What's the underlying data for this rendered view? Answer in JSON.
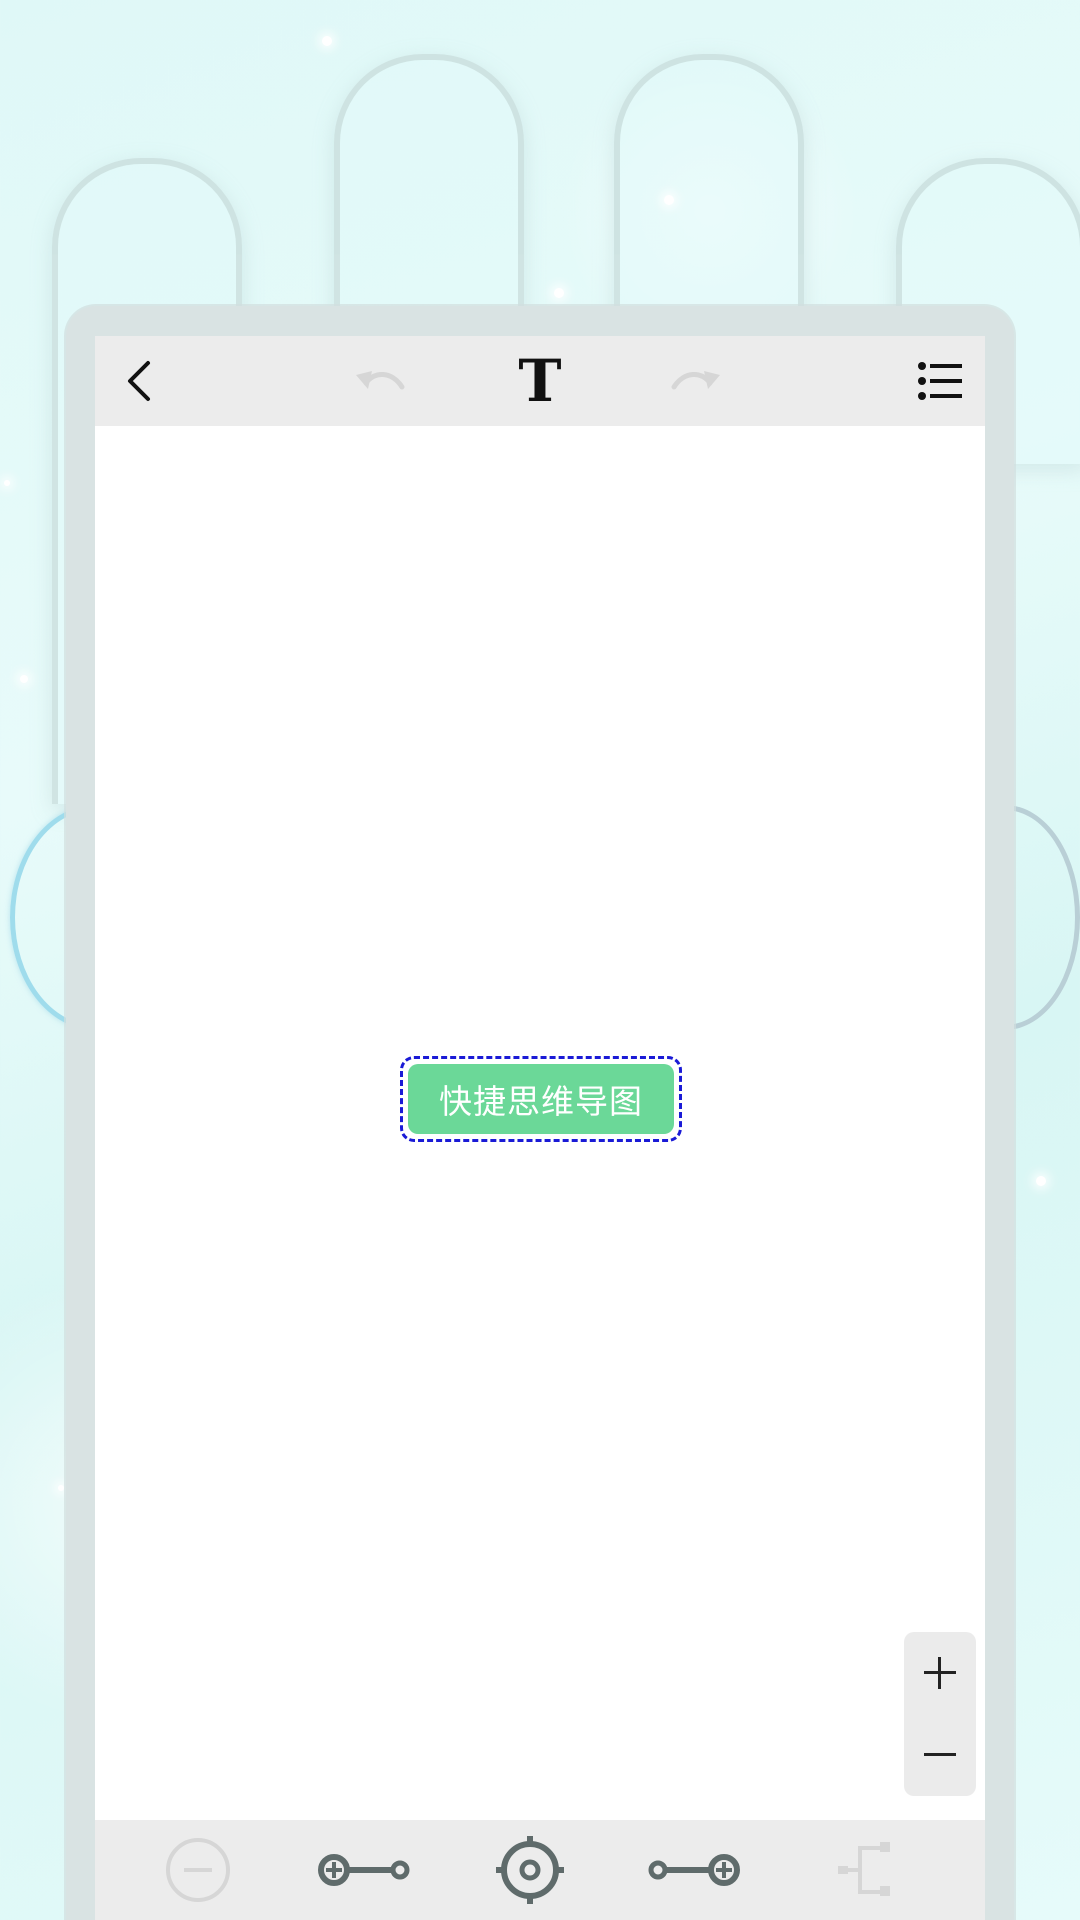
{
  "toolbar": {
    "back_icon": "chevron-left-icon",
    "undo_icon": "undo-icon",
    "text_style_icon": "text-format-icon",
    "text_style_glyph": "T",
    "redo_icon": "redo-icon",
    "outline_icon": "list-icon"
  },
  "mindmap": {
    "root_label": "快捷思维导图",
    "root_color": "#6bd898",
    "selection_color": "#1a1ad6"
  },
  "zoom": {
    "in_label": "+",
    "out_label": "—"
  },
  "bottom_toolbar": {
    "items": [
      {
        "icon": "remove-node-icon",
        "enabled": false
      },
      {
        "icon": "add-sibling-node-icon",
        "enabled": true
      },
      {
        "icon": "locate-center-icon",
        "enabled": true
      },
      {
        "icon": "add-child-node-icon",
        "enabled": true
      },
      {
        "icon": "layout-structure-icon",
        "enabled": false
      }
    ]
  },
  "colors": {
    "toolbar_bg": "#ececec",
    "icon_active": "#5f6b6b",
    "icon_disabled": "#d6d6d6",
    "frame": "#d9e3e3"
  }
}
